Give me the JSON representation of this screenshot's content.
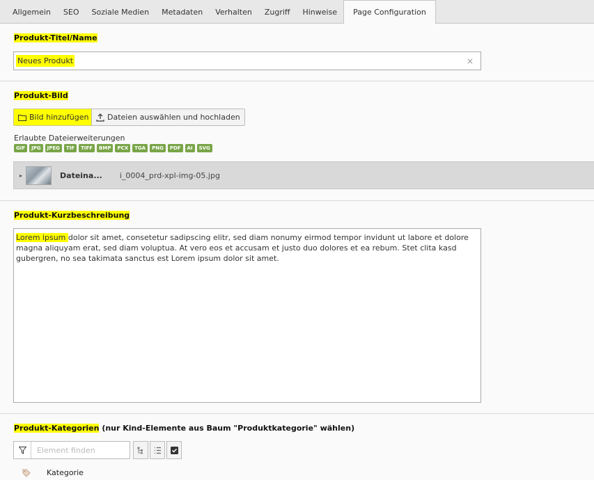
{
  "tabs": [
    "Allgemein",
    "SEO",
    "Soziale Medien",
    "Metadaten",
    "Verhalten",
    "Zugriff",
    "Hinweise",
    "Page Configuration"
  ],
  "active_tab_index": 7,
  "title_field": {
    "label": "Produkt-Titel/Name",
    "value": "Neues Produkt",
    "clear": "×"
  },
  "image_field": {
    "label": "Produkt-Bild",
    "add_label": "Bild hinzufügen",
    "upload_label": "Dateien auswählen und hochladen",
    "allowed_label": "Erlaubte Dateierweiterungen",
    "extensions": [
      "GIF",
      "JPG",
      "JPEG",
      "TIF",
      "TIFF",
      "BMP",
      "PCX",
      "TGA",
      "PNG",
      "PDF",
      "AI",
      "SVG"
    ],
    "file": {
      "title": "Dateina...",
      "name": "i_0004_prd-xpl-img-05.jpg"
    }
  },
  "short_desc": {
    "label": "Produkt-Kurzbeschreibung",
    "text_highlight": "Lorem ipsum ",
    "text_rest": "dolor sit amet, consetetur sadipscing elitr, sed diam nonumy eirmod tempor invidunt ut labore et dolore magna aliquyam erat, sed diam voluptua. At vero eos et accusam et justo duo dolores et ea rebum. Stet clita kasd gubergren, no sea takimata sanctus est Lorem ipsum dolor sit amet."
  },
  "categories": {
    "label": "Produkt-Kategorien",
    "label_note": " (nur Kind-Elemente aus Baum \"Produktkategorie\" wählen)",
    "search_placeholder": "Element finden",
    "tree_item": "Kategorie"
  }
}
